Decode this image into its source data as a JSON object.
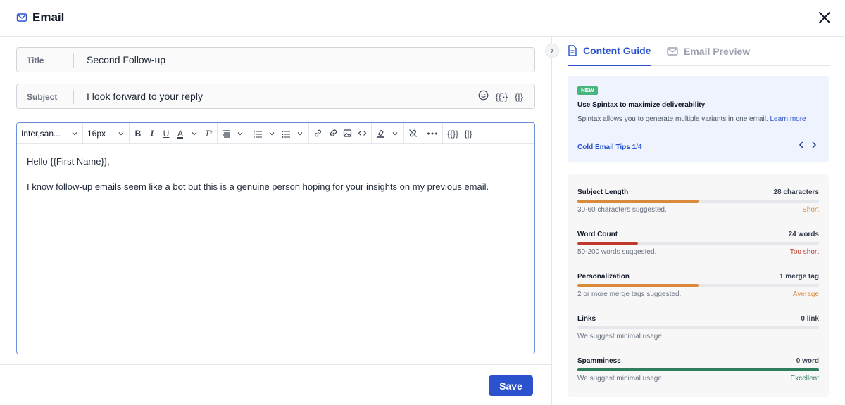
{
  "header": {
    "title": "Email",
    "icon": "mail-icon"
  },
  "form": {
    "title_label": "Title",
    "title_value": "Second Follow-up",
    "subject_label": "Subject",
    "subject_value": "I look forward to your reply",
    "subject_tools": {
      "merge_tag": "{{}}",
      "spintax": "{|}"
    }
  },
  "toolbar": {
    "font_family": "Inter,san...",
    "font_size": "16px",
    "merge_tag": "{{}}",
    "spintax": "{|}"
  },
  "editor": {
    "line1": "Hello {{First Name}},",
    "line2": "I know follow-up emails seem like a bot but this is a genuine person hoping for your insights on my previous email."
  },
  "footer": {
    "save_label": "Save"
  },
  "tabs": [
    {
      "label": "Content Guide",
      "active": true
    },
    {
      "label": "Email Preview",
      "active": false
    }
  ],
  "tip": {
    "badge": "NEW",
    "heading": "Use Spintax to maximize deliverability",
    "description": "Spintax allows you to generate multiple variants in one email.",
    "link": "Learn more",
    "footer": "Cold Email Tips 1/4"
  },
  "metrics": [
    {
      "name": "Subject Length",
      "value": "28 characters",
      "hint": "30-60 characters suggested.",
      "status": "Short",
      "fill": 0.5,
      "color": "#d98a3a",
      "status_color": "#d98a3a"
    },
    {
      "name": "Word Count",
      "value": "24 words",
      "hint": "50-200 words suggested.",
      "status": "Too short",
      "fill": 0.25,
      "color": "#c0392b",
      "status_color": "#c0392b"
    },
    {
      "name": "Personalization",
      "value": "1 merge tag",
      "hint": "2 or more merge tags suggested.",
      "status": "Average",
      "fill": 0.5,
      "color": "#d98a3a",
      "status_color": "#d98a3a"
    },
    {
      "name": "Links",
      "value": "0 link",
      "hint": "We suggest minimal usage.",
      "status": "",
      "fill": 0,
      "color": "#9ca3af",
      "status_color": "#6b7280"
    },
    {
      "name": "Spamminess",
      "value": "0 word",
      "hint": "We suggest minimal usage.",
      "status": "Excellent",
      "fill": 1.0,
      "color": "#2e7d5b",
      "status_color": "#2e7d5b"
    }
  ],
  "colors": {
    "accent": "#2952cc",
    "editor_border": "#6b8fd6",
    "tip_bg": "#eef3fd"
  }
}
